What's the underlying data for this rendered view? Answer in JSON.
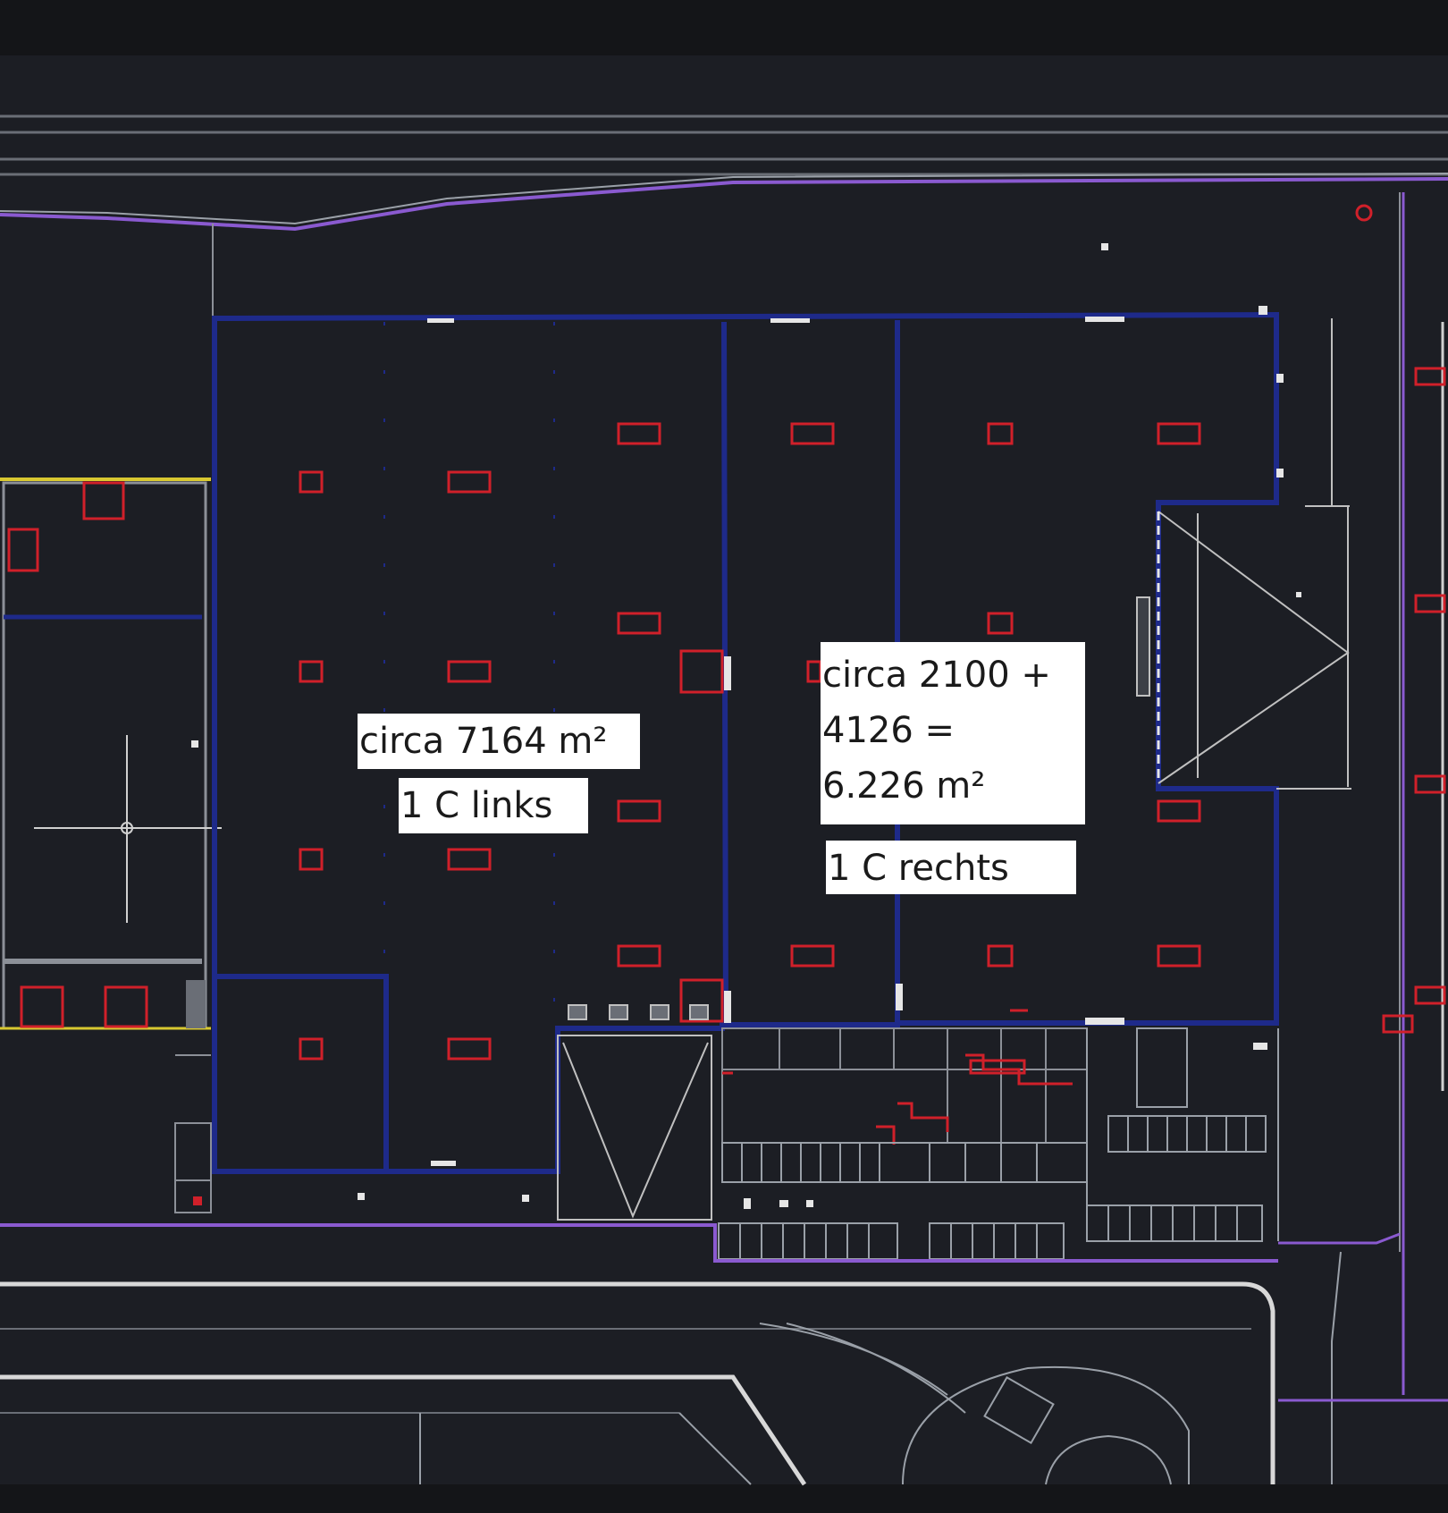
{
  "labels": {
    "left_area": "circa 7164 m²",
    "left_unit": "1 C links",
    "right_area_line1": "circa 2100 +",
    "right_area_line2": "4126 =",
    "right_area_line3": "6.226 m²",
    "right_unit": "1 C rechts"
  },
  "colors": {
    "background": "#1c1e24",
    "wall_blue": "#1e2a8a",
    "red_marks": "#d0202a",
    "purple_boundary": "#8a5ad0",
    "grey_lines": "#8c9098",
    "white_lines": "#e6e6e6",
    "yellow_line": "#d8c830"
  }
}
